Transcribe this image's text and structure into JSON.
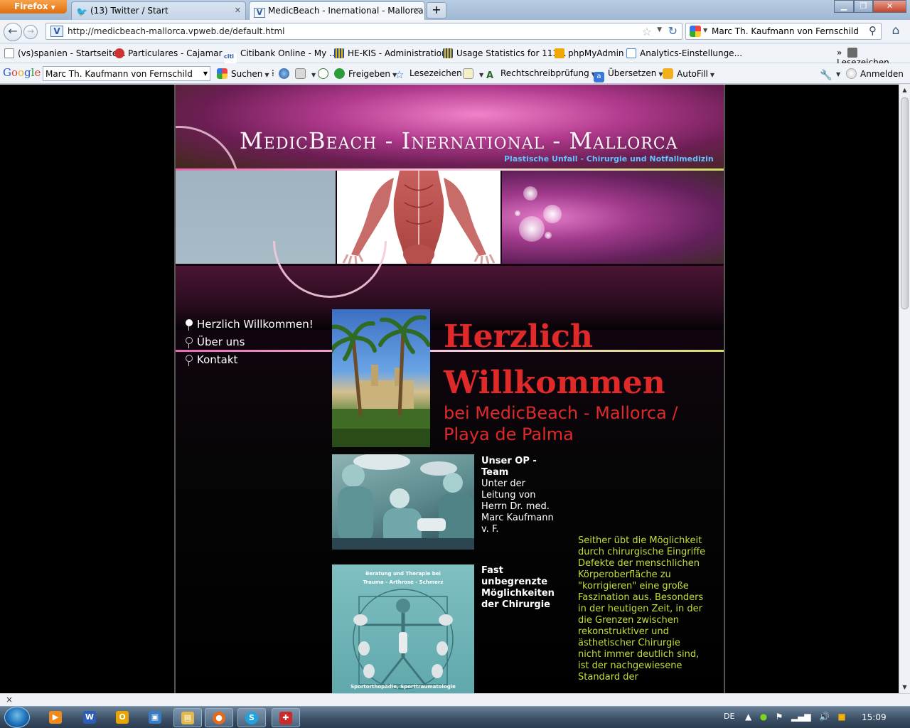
{
  "browser": {
    "app_button": "Firefox",
    "tabs": [
      {
        "label": "(13) Twitter / Start",
        "active": false
      },
      {
        "label": "MedicBeach - Inernational - Mallorca...",
        "active": true
      }
    ],
    "new_tab": "+",
    "url": "http://medicbeach-mallorca.vpweb.de/default.html",
    "url_icon": "V",
    "search_engine_value": "Marc Th. Kaufmann von Fernschild"
  },
  "bookmarks": {
    "items": [
      {
        "label": "(vs)spanien - Startseite...",
        "icon_color": "#ffffff"
      },
      {
        "label": "Particulares - Cajamar ...",
        "icon_color": "#d0322f"
      },
      {
        "label": "Citibank Online - My ...",
        "icon_color": "#1e4fa2"
      },
      {
        "label": "HE-KIS - Administration",
        "icon_color": "#2d4a8a"
      },
      {
        "label": "Usage Statistics for 113...",
        "icon_color": "#2d4a8a"
      },
      {
        "label": "phpMyAdmin",
        "icon_color": "#f0a800"
      },
      {
        "label": "Analytics-Einstellunge...",
        "icon_color": "#4a8ad8"
      }
    ],
    "more": "»",
    "folder": "Lesezeichen"
  },
  "google_toolbar": {
    "logo": {
      "g1": "G",
      "g2": "o",
      "g3": "o",
      "g4": "g",
      "g5": "l",
      "g6": "e"
    },
    "query": "Marc Th. Kaufmann von Fernschild",
    "items": {
      "search": "Suchen",
      "share": "Freigeben",
      "bookmarks": "Lesezeichen",
      "spellcheck": "Rechtschreibprüfung",
      "translate": "Übersetzen",
      "autofill": "AutoFill",
      "signin": "Anmelden"
    }
  },
  "site": {
    "title": "MedicBeach - Inernational - Mallorca",
    "subtitle": "Plastische Unfall - Chirurgie und Notfallmedizin",
    "menu": [
      {
        "label": "Herzlich Willkommen!",
        "active": true
      },
      {
        "label": "Über uns",
        "active": false
      },
      {
        "label": "Kontakt",
        "active": false
      }
    ],
    "welcome_title": "Herzlich Willkommen",
    "welcome_subtitle": "bei MedicBeach - Mallorca / Playa de Palma",
    "op_team": {
      "heading": "Unser OP - Team",
      "text": "Unter der Leitung von Herrn Dr. med. Marc Kaufmann v. F."
    },
    "chirurgie": {
      "heading": "Fast unbegrenzte Möglichkeiten der Chirurgie",
      "image_caption_top": "Beratung und Therapie bei",
      "image_caption_mid": "Trauma - Arthrose - Schmerz",
      "image_caption_bottom": "Sportorthopädie, Sporttraumatologie"
    },
    "side_text": "Seither übt die Möglichkeit durch chirurgische Eingriffe Defekte der menschlichen Körperoberfläche zu \"korrigieren\" eine große Faszination aus. Besonders in der heutigen Zeit, in der die Grenzen zwischen rekonstruktiver und ästhetischer Chirurgie nicht immer deutlich sind, ist der nachgewiesene Standard der"
  },
  "status": {
    "close": "×"
  },
  "taskbar": {
    "language": "DE",
    "clock": "15:09",
    "apps": [
      {
        "name": "media-player",
        "glyph": "▶",
        "color": "#f08a1c"
      },
      {
        "name": "word",
        "glyph": "W",
        "color": "#2b5cb8"
      },
      {
        "name": "outlook",
        "glyph": "O",
        "color": "#e8a400"
      },
      {
        "name": "remote",
        "glyph": "▣",
        "color": "#3a7cc4"
      },
      {
        "name": "explorer",
        "glyph": "▤",
        "color": "#e2b84a"
      },
      {
        "name": "firefox",
        "glyph": "●",
        "color": "#e36b1b"
      },
      {
        "name": "skype",
        "glyph": "S",
        "color": "#1fa3e0"
      },
      {
        "name": "app-red",
        "glyph": "✚",
        "color": "#cc2a2a"
      }
    ]
  }
}
